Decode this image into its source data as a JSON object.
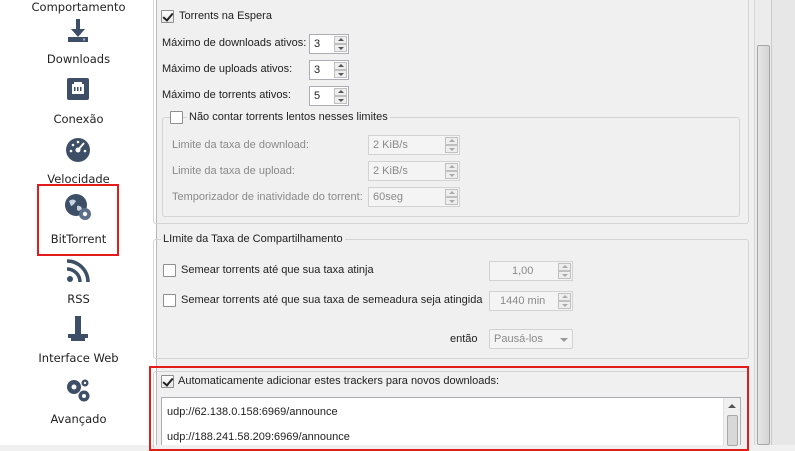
{
  "sidebar": {
    "items": [
      {
        "label": "Comportamento",
        "icon": "gears-monitor-icon"
      },
      {
        "label": "Downloads",
        "icon": "download-arrow-icon"
      },
      {
        "label": "Conexão",
        "icon": "network-port-icon"
      },
      {
        "label": "Velocidade",
        "icon": "speedometer-icon"
      },
      {
        "label": "BitTorrent",
        "icon": "globe-gear-icon",
        "selected": true
      },
      {
        "label": "RSS",
        "icon": "rss-icon"
      },
      {
        "label": "Interface Web",
        "icon": "web-interface-icon"
      },
      {
        "label": "Avançado",
        "icon": "gears-icon"
      }
    ]
  },
  "queue": {
    "enabled_label": "Torrents na Espera",
    "enabled": true,
    "max_downloads_label": "Máximo de downloads ativos:",
    "max_downloads": "3",
    "max_uploads_label": "Máximo de uploads ativos:",
    "max_uploads": "3",
    "max_torrents_label": "Máximo de torrents ativos:",
    "max_torrents": "5",
    "slow": {
      "label": "Não contar torrents lentos nesses limites",
      "enabled": false,
      "download_rate_label": "Limite da taxa de download:",
      "download_rate": "2 KiB/s",
      "upload_rate_label": "Limite da taxa de upload:",
      "upload_rate": "2 KiB/s",
      "inactivity_label": "Temporizador de inatividade do torrent:",
      "inactivity": "60seg"
    }
  },
  "share_limit": {
    "title": "LImite da Taxa de Compartilhamento",
    "ratio_label": "Semear torrents até que sua taxa atinja",
    "ratio_value": "1,00",
    "time_label": "Semear torrents até que sua taxa de semeadura seja atingida",
    "time_value": "1440 min",
    "then_label": "então",
    "then_value": "Pausá-los"
  },
  "trackers": {
    "label": "Automaticamente adicionar estes trackers para novos downloads:",
    "enabled": true,
    "lines": [
      "udp://62.138.0.158:6969/announce",
      "udp://188.241.58.209:6969/announce"
    ]
  },
  "colors": {
    "highlight": "#e41b1b"
  }
}
